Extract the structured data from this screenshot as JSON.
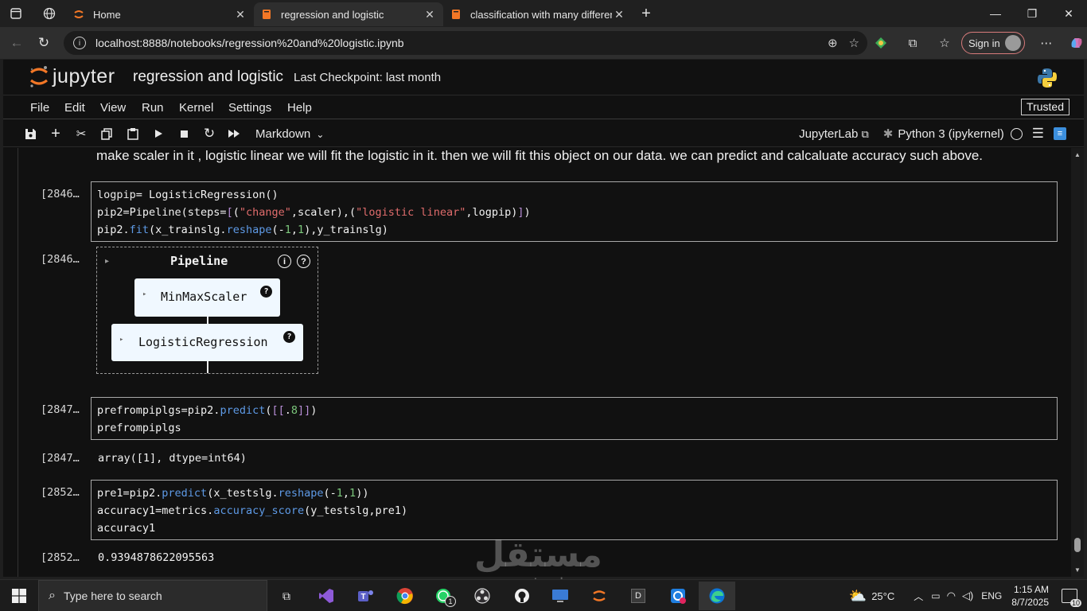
{
  "browser": {
    "tabs": [
      {
        "title": "Home",
        "active": false
      },
      {
        "title": "regression and logistic",
        "active": true
      },
      {
        "title": "classification with many different",
        "active": false
      }
    ],
    "url": "localhost:8888/notebooks/regression%20and%20logistic.ipynb",
    "sign_in_label": "Sign in"
  },
  "jupyter": {
    "logo_text": "jupyter",
    "notebook_title": "regression and logistic",
    "checkpoint": "Last Checkpoint: last month",
    "menu": [
      "File",
      "Edit",
      "View",
      "Run",
      "Kernel",
      "Settings",
      "Help"
    ],
    "trusted": "Trusted",
    "cell_type": "Markdown",
    "jupyterlab_link": "JupyterLab",
    "kernel_name": "Python 3 (ipykernel)"
  },
  "cells": {
    "markdown_text": "make scaler in it , logistic linear we will fit the logistic in it. then we will fit this object on our data. we can predict and calcaluate accuracy such above.",
    "c1_prompt": "[2846…",
    "c1_out_prompt": "[2846…",
    "pipeline": {
      "title": "Pipeline",
      "step1": "MinMaxScaler",
      "step2": "LogisticRegression",
      "info_icon": "i",
      "help_icon": "?"
    },
    "c2_prompt": "[2847…",
    "c2_out_prompt": "[2847…",
    "c2_output": "array([1], dtype=int64)",
    "c3_prompt": "[2852…",
    "c3_out_prompt": "[2852…",
    "c3_output": "0.9394878622095563"
  },
  "taskbar": {
    "search_placeholder": "Type here to search",
    "weather": "25°C",
    "language": "ENG",
    "time": "1:15 AM",
    "date": "8/7/2025",
    "notification_count": "10",
    "whatsapp_badge": "1"
  },
  "watermark": {
    "text": "مستقل",
    "url": "mostaql.com"
  },
  "colors": {
    "function": "#5e9ae6",
    "string": "#e06c6c",
    "number": "#7cc87c",
    "accent_jupyter": "#f37726"
  }
}
